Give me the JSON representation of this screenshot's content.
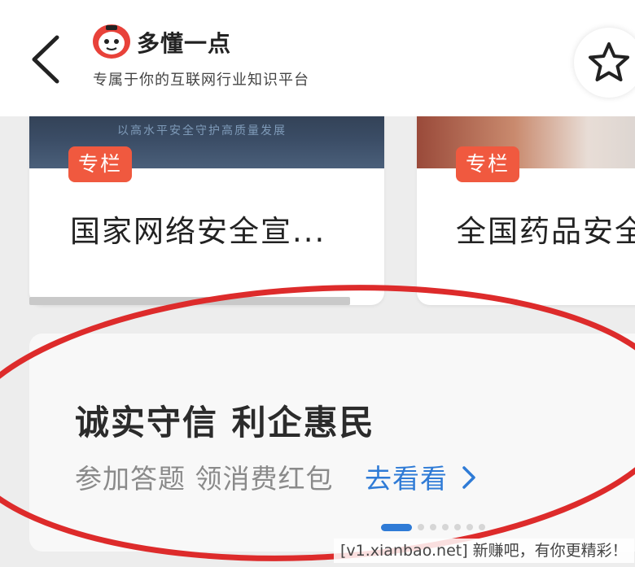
{
  "header": {
    "brand_name": "多懂一点",
    "brand_tagline": "专属于你的互联网行业知识平台",
    "back_icon": "chevron-left-icon",
    "favorite_icon": "star-icon"
  },
  "cards": [
    {
      "thumb_sub": "以高水平安全守护高质量发展",
      "badge": "专栏",
      "title": "国家网络安全宣..."
    },
    {
      "badge": "专栏",
      "title": "全国药品安全"
    }
  ],
  "banner": {
    "title": "诚实守信 利企惠民",
    "subtitle": "参加答题 领消费红包",
    "link": "去看看",
    "carousel": {
      "total": 7,
      "active": 1
    }
  },
  "watermark": "[v1.xianbao.net] 新赚吧，有你更精彩！",
  "colors": {
    "accent_blue": "#2f7bd6",
    "badge_red": "#f0593f",
    "annotation_red": "#dd2b2b"
  }
}
